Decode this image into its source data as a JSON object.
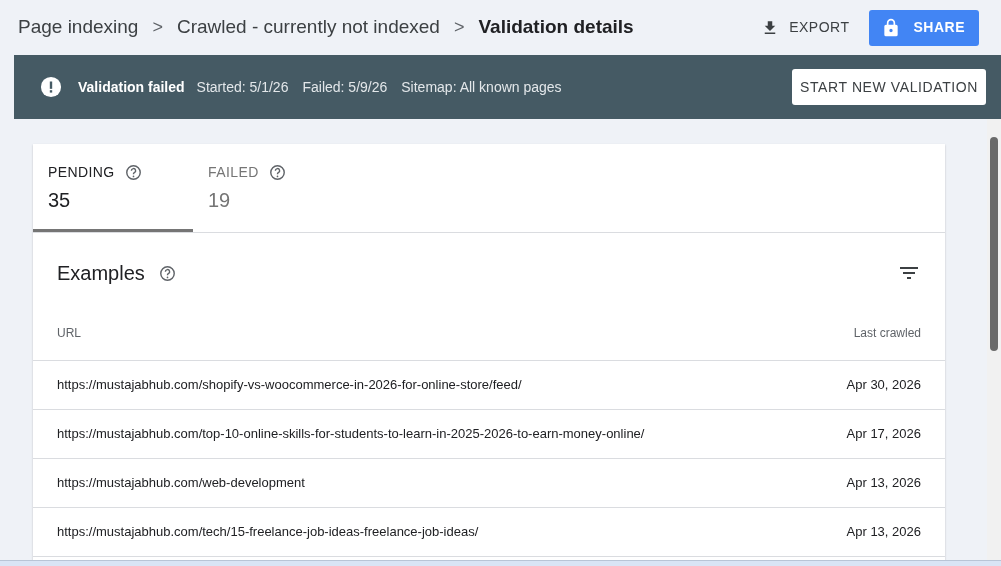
{
  "breadcrumbs": [
    {
      "label": "Page indexing",
      "current": false
    },
    {
      "label": "Crawled - currently not indexed",
      "current": false
    },
    {
      "label": "Validation details",
      "current": true
    }
  ],
  "separator": ">",
  "actions": {
    "export": "EXPORT",
    "share": "SHARE"
  },
  "banner": {
    "status": "Validation failed",
    "started": "Started: 5/1/26",
    "failed": "Failed: 5/9/26",
    "sitemap": "Sitemap: All known pages",
    "button": "START NEW VALIDATION"
  },
  "tabs": [
    {
      "label": "PENDING",
      "count": "35",
      "selected": true
    },
    {
      "label": "FAILED",
      "count": "19",
      "selected": false
    }
  ],
  "examples": {
    "title": "Examples",
    "columns": [
      "URL",
      "Last crawled"
    ],
    "rows": [
      {
        "url": "https://mustajabhub.com/shopify-vs-woocommerce-in-2026-for-online-store/feed/",
        "date": "Apr 30, 2026"
      },
      {
        "url": "https://mustajabhub.com/top-10-online-skills-for-students-to-learn-in-2025-2026-to-earn-money-online/",
        "date": "Apr 17, 2026"
      },
      {
        "url": "https://mustajabhub.com/web-development",
        "date": "Apr 13, 2026"
      },
      {
        "url": "https://mustajabhub.com/tech/15-freelance-job-ideas-freelance-job-ideas/",
        "date": "Apr 13, 2026"
      }
    ]
  }
}
